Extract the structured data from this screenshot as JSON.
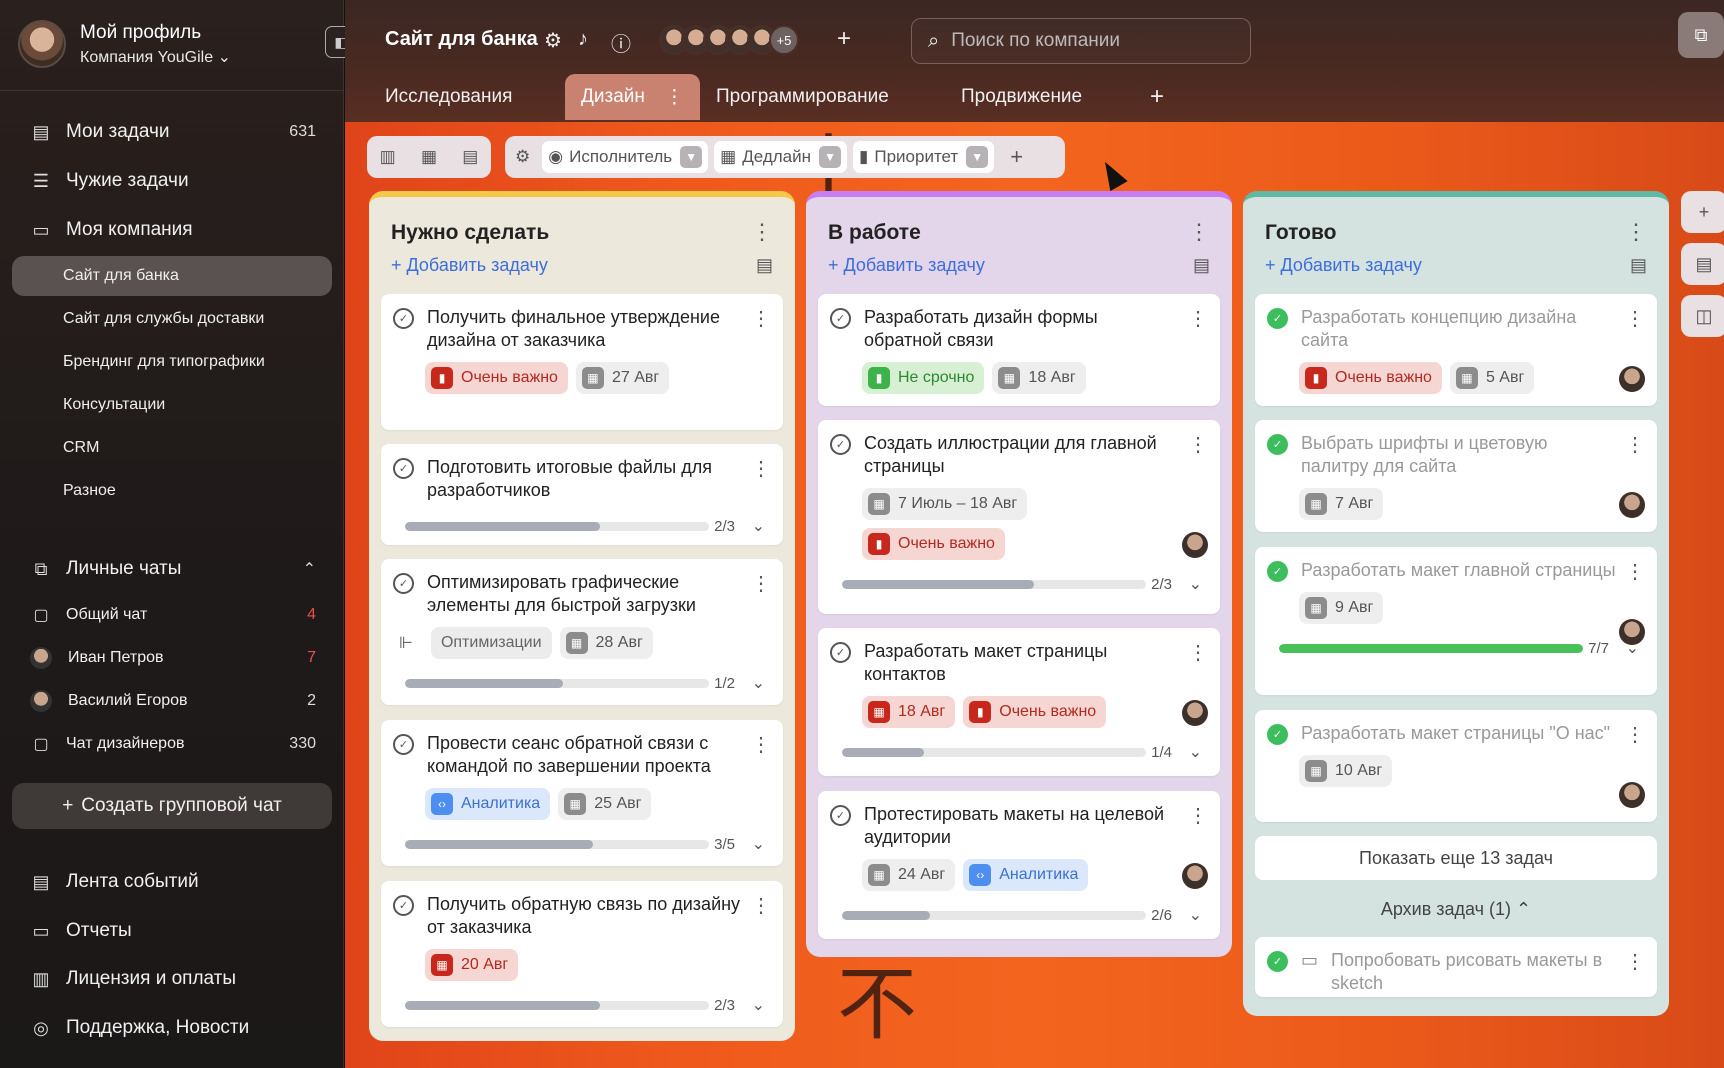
{
  "profile": {
    "name": "Мой профиль",
    "company": "Компания YouGile ⌄"
  },
  "nav": {
    "my_tasks": "Мои задачи",
    "my_tasks_count": "631",
    "others_tasks": "Чужие задачи",
    "my_company": "Моя компания",
    "projects": [
      "Сайт для банка",
      "Сайт для службы доставки",
      "Брендинг для типографики",
      "Консультации",
      "CRM",
      "Разное"
    ],
    "personal_chats": "Личные чаты",
    "chats": [
      {
        "name": "Общий чат",
        "count": "4"
      },
      {
        "name": "Иван Петров",
        "count": "7"
      },
      {
        "name": "Василий Егоров",
        "count": "2"
      },
      {
        "name": "Чат дизайнеров",
        "count": "330"
      }
    ],
    "create_chat": "Создать групповой чат",
    "feed": "Лента событий",
    "reports": "Отчеты",
    "license": "Лицензия и оплаты",
    "support": "Поддержка, Новости"
  },
  "header": {
    "title": "Сайт для банка",
    "more_users": "+5",
    "search_placeholder": "Поиск по компании"
  },
  "tabs": [
    "Исследования",
    "Дизайн",
    "Программирование",
    "Продвижение"
  ],
  "filters": [
    "Исполнитель",
    "Дедлайн",
    "Приоритет"
  ],
  "columns": [
    {
      "title": "Нужно сделать",
      "add": "Добавить задачу",
      "cards": [
        {
          "title": "Получить финальное утверждение дизайна от заказчика",
          "priority": "Очень важно",
          "date": "27 Авг"
        },
        {
          "title": "Подготовить итоговые файлы для разработчиков",
          "progress": "2/3"
        },
        {
          "title": "Оптимизировать графические элементы для быстрой загрузки",
          "tag": "Оптимизации",
          "date": "28 Авг",
          "progress": "1/2"
        },
        {
          "title": "Провести сеанс обратной связи с командой по завершении проекта",
          "tag": "Аналитика",
          "date": "25 Авг",
          "progress": "3/5"
        },
        {
          "title": "Получить обратную связь по дизайну от заказчика",
          "date": "20 Авг",
          "progress": "2/3"
        }
      ]
    },
    {
      "title": "В работе",
      "add": "Добавить задачу",
      "cards": [
        {
          "title": "Разработать дизайн формы обратной связи",
          "priority": "Не срочно",
          "date": "18 Авг"
        },
        {
          "title": "Создать иллюстрации для главной страницы",
          "date": "7 Июль – 18 Авг",
          "priority": "Очень важно",
          "progress": "2/3"
        },
        {
          "title": "Разработать макет страницы контактов",
          "date": "18 Авг",
          "priority": "Очень важно",
          "progress": "1/4"
        },
        {
          "title": "Протестировать макеты на целевой аудитории",
          "date": "24 Авг",
          "tag": "Аналитика",
          "progress": "2/6"
        }
      ]
    },
    {
      "title": "Готово",
      "add": "Добавить задачу",
      "cards": [
        {
          "title": "Разработать концепцию дизайна сайта",
          "priority": "Очень важно",
          "date": "5 Авг"
        },
        {
          "title": "Выбрать шрифты и цветовую палитру для сайта",
          "date": "7 Авг"
        },
        {
          "title": "Разработать макет главной страницы",
          "date": "9 Авг",
          "progress": "7/7"
        },
        {
          "title": "Разработать макет страницы \"О нас\"",
          "date": "10 Авг"
        }
      ],
      "show_more": "Показать еще 13 задач",
      "archive": "Архив задач (1) ⌃",
      "archived": "Попробовать рисовать макеты в sketch"
    }
  ],
  "progress_fractions": {
    "c1_2": 0.64,
    "c1_3": 0.52,
    "c1_4": 0.62,
    "c1_5": 0.64,
    "c2_2": 0.63,
    "c2_3": 0.27,
    "c2_4": 0.29,
    "c3_3": 1.0
  }
}
